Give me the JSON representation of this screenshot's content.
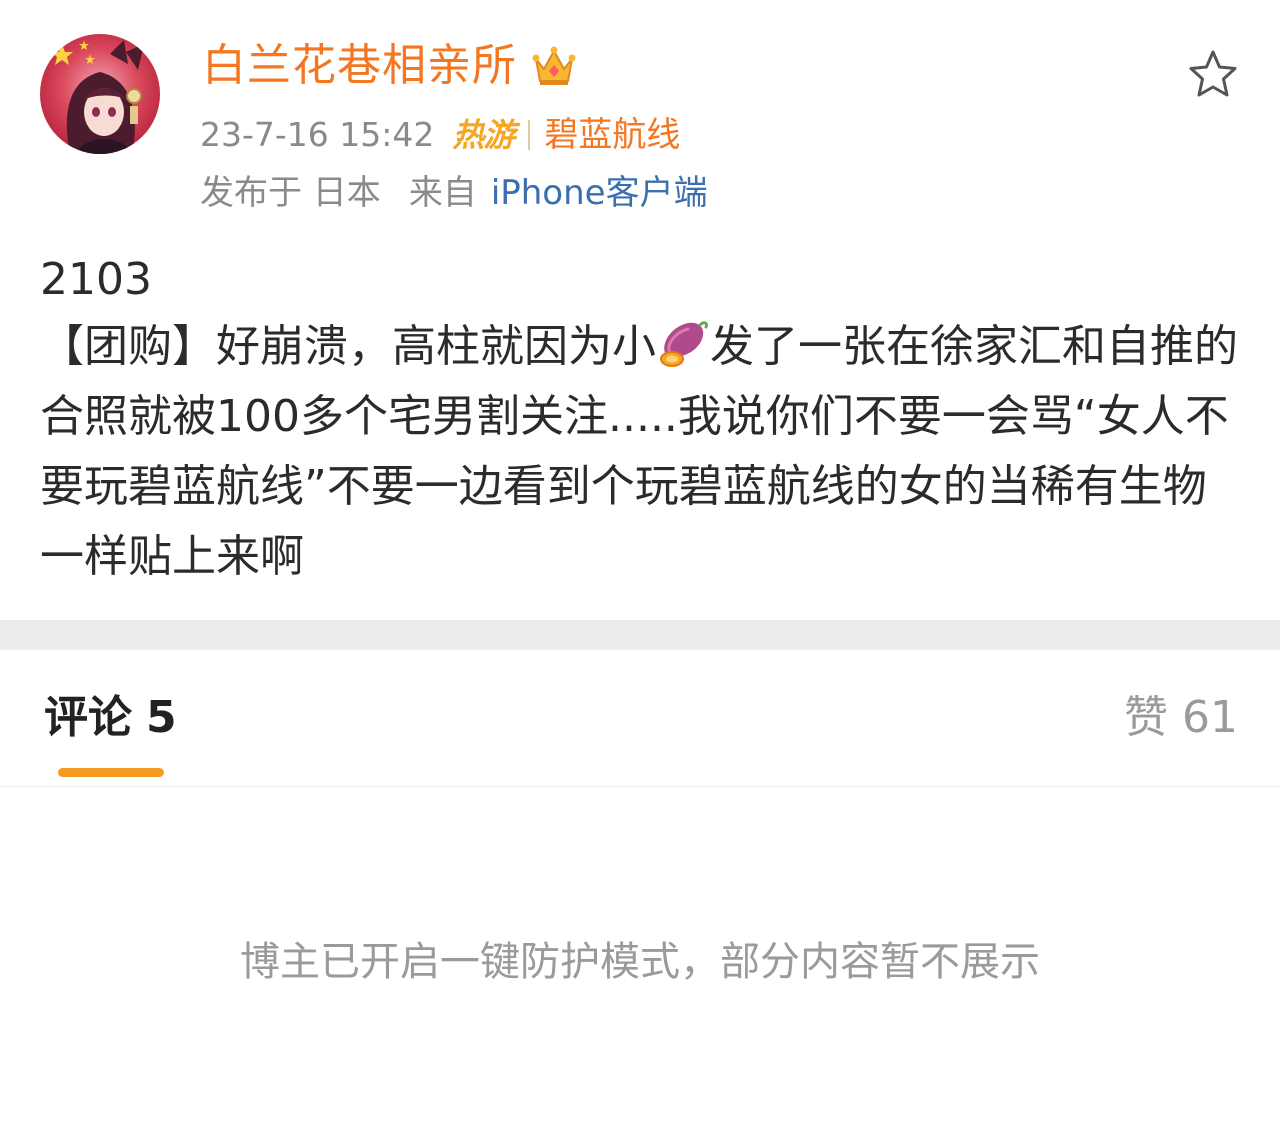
{
  "post": {
    "author": {
      "name": "白兰花巷相亲所",
      "avatar_icon": "anime-girl-avatar",
      "badge_icon": "crown-icon"
    },
    "timestamp": "23-7-16 15:42",
    "hot_tag": "热游",
    "topic": "碧蓝航线",
    "location": "发布于 日本",
    "source_prefix": "来自",
    "source_device": "iPhone客户端",
    "favorite_icon": "star-outline-icon",
    "number": "2103",
    "text_part1": "【团购】好崩溃，高柱就因为小",
    "inline_icon": "sweet-potato-icon",
    "text_part2": "发了一张在徐家汇和自推的合照就被100多个宅男割关注.....我说你们不要一会骂“女人不要玩碧蓝航线”不要一边看到个玩碧蓝航线的女的当稀有生物一样贴上来啊"
  },
  "comments": {
    "tab_label": "评论",
    "tab_count": "5",
    "likes_label": "赞",
    "likes_count": "61",
    "protection_notice": "博主已开启一键防护模式，部分内容暂不展示"
  },
  "colors": {
    "username": "#f47621",
    "hot_tag": "#f5a623",
    "link_blue": "#3a6fb0",
    "tab_indicator": "#f59a23",
    "muted_text": "#8a8a8a",
    "divider": "#ececec"
  }
}
